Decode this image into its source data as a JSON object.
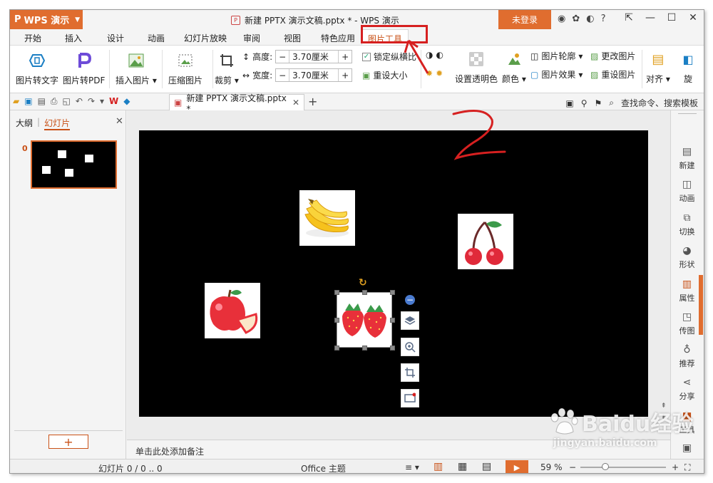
{
  "app": {
    "name": "WPS 演示",
    "logo": "P",
    "window_title": "新建 PPTX 演示文稿.pptx * - WPS 演示",
    "login_label": "未登录",
    "brand_color": "#e06d2f"
  },
  "menu_tabs": [
    "开始",
    "插入",
    "设计",
    "动画",
    "幻灯片放映",
    "审阅",
    "视图",
    "特色应用",
    "图片工具"
  ],
  "active_tab": "图片工具",
  "ribbon": {
    "pic_to_text": "图片转文字",
    "pic_to_pdf": "图片转PDF",
    "insert_pic": "插入图片",
    "compress_pic": "压缩图片",
    "crop": "裁剪",
    "height_label": "高度:",
    "height_value": "3.70厘米",
    "width_label": "宽度:",
    "width_value": "3.70厘米",
    "lock_ratio": "锁定纵横比",
    "reset_size": "重设大小",
    "set_transparent": "设置透明色",
    "color": "颜色",
    "pic_outline": "图片轮廓",
    "pic_effect": "图片效果",
    "change_pic": "更改图片",
    "reset_pic": "重设图片",
    "align": "对齐",
    "rotate": "旋"
  },
  "quickbar": {
    "doc_tab": "新建 PPTX 演示文稿.pptx *",
    "search": "查找命令、搜索模板"
  },
  "left_panel": {
    "tab_outline": "大纲",
    "tab_slides": "幻灯片",
    "slide_number": "0"
  },
  "notes_placeholder": "单击此处添加备注",
  "right_panel": [
    "新建",
    "动画",
    "切换",
    "形状",
    "属性",
    "传图",
    "推荐",
    "分享",
    "工具"
  ],
  "right_panel_active": "属性",
  "status": {
    "slide_info": "幻灯片 0 / 0 .. 0",
    "theme": "Office 主题",
    "zoom": "59 %"
  },
  "annotation": {
    "step_number": "2",
    "color": "#d62020"
  },
  "watermark": {
    "brand": "Baidu经验",
    "url": "jingyan.baidu.com"
  },
  "slide_images": [
    "banana",
    "cherry",
    "apple",
    "strawberry"
  ]
}
